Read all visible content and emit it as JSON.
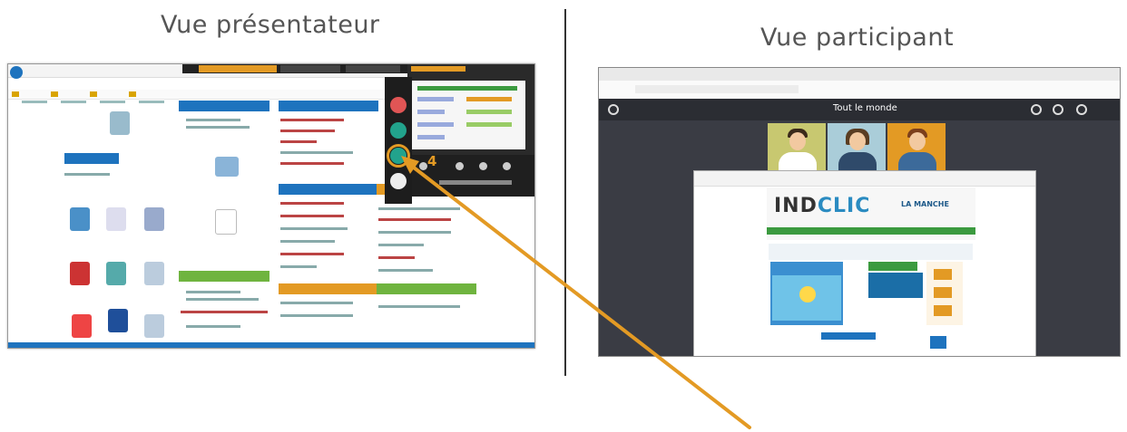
{
  "headings": {
    "presenter": "Vue présentateur",
    "participant": "Vue participant"
  },
  "participant_view": {
    "meeting_title": "Tout le monde",
    "shared_site_logo": "IN D CLIC",
    "shared_site_logo_main": "IND",
    "shared_site_logo_rest": "CLIC",
    "shared_site_brand": "LA MANCHE"
  },
  "presenter_view": {
    "annotation_number": "4"
  },
  "colors": {
    "arrow": "#e39a24",
    "jitsi_green": "#22a38c",
    "brand_blue": "#1e73be",
    "brand_green": "#6fb43f",
    "brand_orange": "#e39a24"
  }
}
